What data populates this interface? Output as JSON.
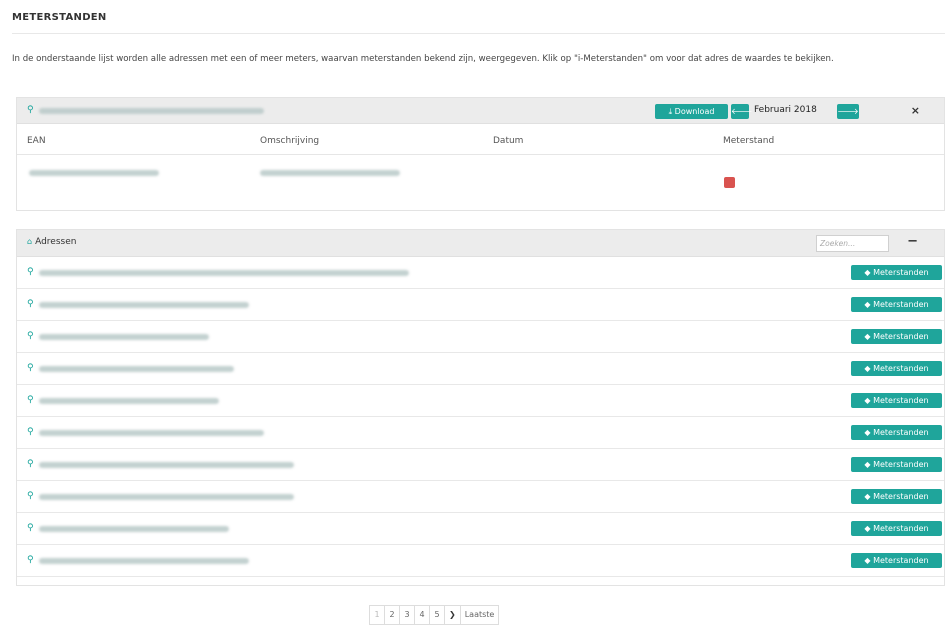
{
  "page": {
    "title": "METERSTANDEN",
    "intro": "In de onderstaande lijst worden alle adressen met een of meer meters, waarvan meterstanden bekend zijn, weergegeven. Klik op \"i-Meterstanden\" om voor dat adres de waardes te bekijken."
  },
  "detail": {
    "download_label": "Download",
    "prev_icon": "arrow-left-icon",
    "next_icon": "arrow-right-icon",
    "month": "Februari 2018",
    "close_label": "×",
    "columns": [
      "EAN",
      "Omschrijving",
      "Datum",
      "Meterstand"
    ]
  },
  "adressen": {
    "title": "Adressen",
    "search_placeholder": "Zoeken...",
    "collapse_label": "−",
    "row_button_label": "Meterstanden",
    "rows": 10
  },
  "pagination": {
    "pages": [
      "1",
      "2",
      "3",
      "4",
      "5"
    ],
    "current": "1",
    "next": "❯",
    "last": "Laatste"
  },
  "colors": {
    "accent": "#1fa59b",
    "danger": "#d9534f",
    "panel_header": "#ececec"
  }
}
